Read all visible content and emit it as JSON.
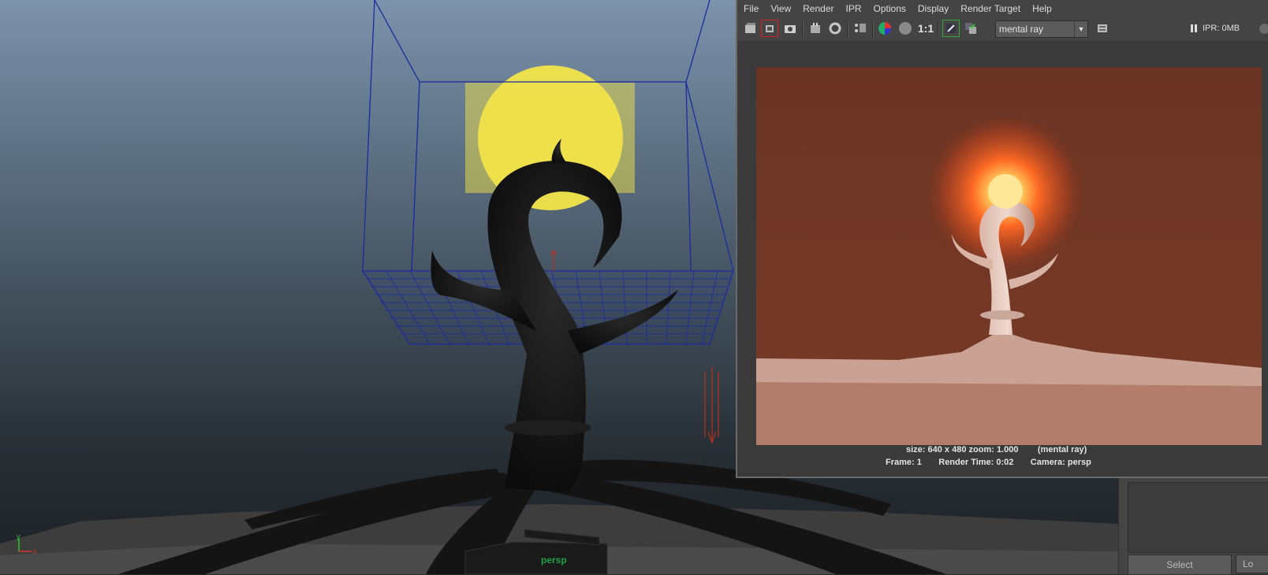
{
  "viewport": {
    "camera_label": "persp",
    "axis": {
      "x_label": "x",
      "y_label": "y"
    },
    "colors": {
      "sun": "#f4e84a",
      "wire": "#1a2a9a",
      "manip": "#c03020",
      "tree": "#141414",
      "camera_label": "#1fa14a"
    }
  },
  "side_panel": {
    "select_label": "Select",
    "second_label": "Lo"
  },
  "render_view": {
    "menu": [
      "File",
      "View",
      "Render",
      "IPR",
      "Options",
      "Display",
      "Render Target",
      "Help"
    ],
    "toolbar": {
      "icons": [
        "render-frame-icon",
        "render-region-icon",
        "snapshot-icon",
        "ipr-render-icon",
        "refresh-ipr-icon",
        "render-settings-icon",
        "rgb-channels-icon",
        "alpha-channel-icon"
      ],
      "ratio_label": "1:1",
      "extra_icons": [
        "display-real-size-icon",
        "compare-icon",
        "keep-image-icon"
      ],
      "renderer": "mental ray",
      "ipr_memory": "IPR: 0MB"
    },
    "status": {
      "line1": "size: 640 x 480 zoom: 1.000        (mental ray)",
      "line2": "Frame: 1       Render Time: 0:02       Camera: persp"
    },
    "colors": {
      "background": "#6a3222",
      "ground": "#b27d6a",
      "glow": "#ff5a1a"
    }
  }
}
